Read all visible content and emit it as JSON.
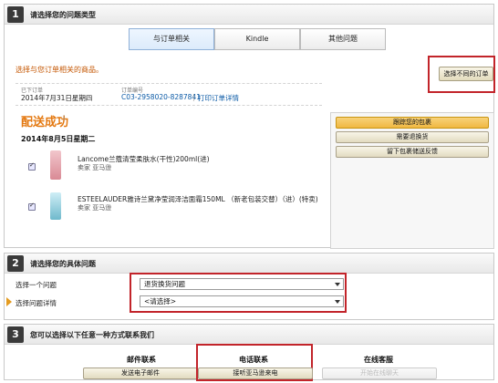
{
  "section1": {
    "number": "1",
    "title": "请选择您的问题类型",
    "tabs": [
      "与订单相关",
      "Kindle",
      "其他问题"
    ],
    "prompt": "选择与您订单相关的商品。",
    "select_different_order": "选择不同的订单",
    "order": {
      "date_label": "已下订单",
      "date_value": "2014年7月31日星期四",
      "number_label": "订单编号",
      "number_value": "C03-2958020-8287841",
      "separator": "|",
      "print_link": "打印订单详情"
    },
    "shipping_status": "配送成功",
    "info_mark": "i",
    "ship_date": "2014年8月5日星期二",
    "items": [
      {
        "name": "Lancome兰蔻清莹柔肤水(干性)200ml(进)",
        "seller": "卖家 亚马逊",
        "thumb_color": "#e7a9b0"
      },
      {
        "name": "ESTEELAUDER雅诗兰黛净莹润泽洁面霜150ML （新老包装交替）（进）(特卖)",
        "seller": "卖家 亚马逊",
        "thumb_color": "#7fc4d6"
      }
    ],
    "actions": [
      "跟踪您的包裹",
      "需要退换货",
      "留下包裹储送反馈"
    ]
  },
  "section2": {
    "number": "2",
    "title": "请选择您的具体问题",
    "problem_label": "选择一个问题",
    "problem_value": "退货换货问题",
    "detail_label": "选择问题详情",
    "detail_value": "<请选择>"
  },
  "section3": {
    "number": "3",
    "title": "您可以选择以下任意一种方式联系我们",
    "columns": [
      {
        "title": "邮件联系",
        "button": "发送电子邮件"
      },
      {
        "title": "电话联系",
        "button": "接听亚马逊来电"
      },
      {
        "title": "在线客服",
        "button": "开始在线聊天"
      }
    ]
  },
  "colors": {
    "accent_orange": "#e47911",
    "highlight_red": "#c2242a",
    "link_blue": "#0b5aa6"
  }
}
